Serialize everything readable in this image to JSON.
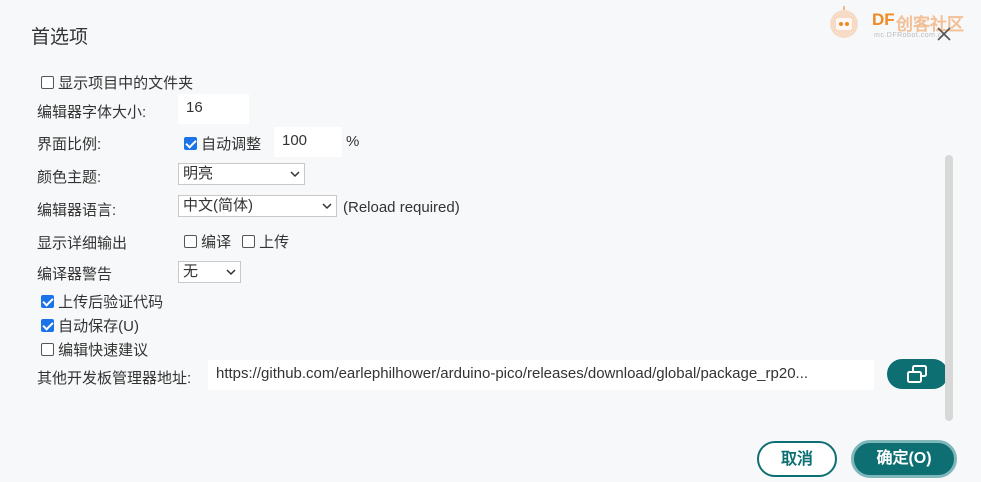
{
  "dialog": {
    "title": "首选项"
  },
  "watermark": {
    "brand": "DF",
    "brand_cn": "创客社区",
    "sub": "mc.DFRobot.com.cn"
  },
  "prefs": {
    "show_sketch_folder": {
      "checked": false,
      "label": "显示项目中的文件夹"
    },
    "editor_font_size": {
      "label": "编辑器字体大小:",
      "value": "16"
    },
    "interface_scale": {
      "label": "界面比例:",
      "auto_checked": true,
      "auto_label": "自动调整",
      "value": "100",
      "unit": "%"
    },
    "theme": {
      "label": "颜色主题:",
      "selected": "明亮"
    },
    "editor_language": {
      "label": "编辑器语言:",
      "selected": "中文(简体)",
      "note": "(Reload required)"
    },
    "verbose_output": {
      "label": "显示详细输出",
      "compile_checked": false,
      "compile_label": "编译",
      "upload_checked": false,
      "upload_label": "上传"
    },
    "compiler_warnings": {
      "label": "编译器警告",
      "selected": "无"
    },
    "verify_after_upload": {
      "checked": true,
      "label": "上传后验证代码"
    },
    "auto_save": {
      "checked": true,
      "label": "自动保存(U)"
    },
    "quick_suggestions": {
      "checked": false,
      "label": "编辑快速建议"
    },
    "board_manager_urls": {
      "label": "其他开发板管理器地址:",
      "value": "https://github.com/earlephilhower/arduino-pico/releases/download/global/package_rp20..."
    }
  },
  "buttons": {
    "cancel": "取消",
    "ok": "确定(O)"
  },
  "colors": {
    "accent": "#0e6f73",
    "checkbox": "#1a73e8",
    "background": "#f7f8f9"
  }
}
